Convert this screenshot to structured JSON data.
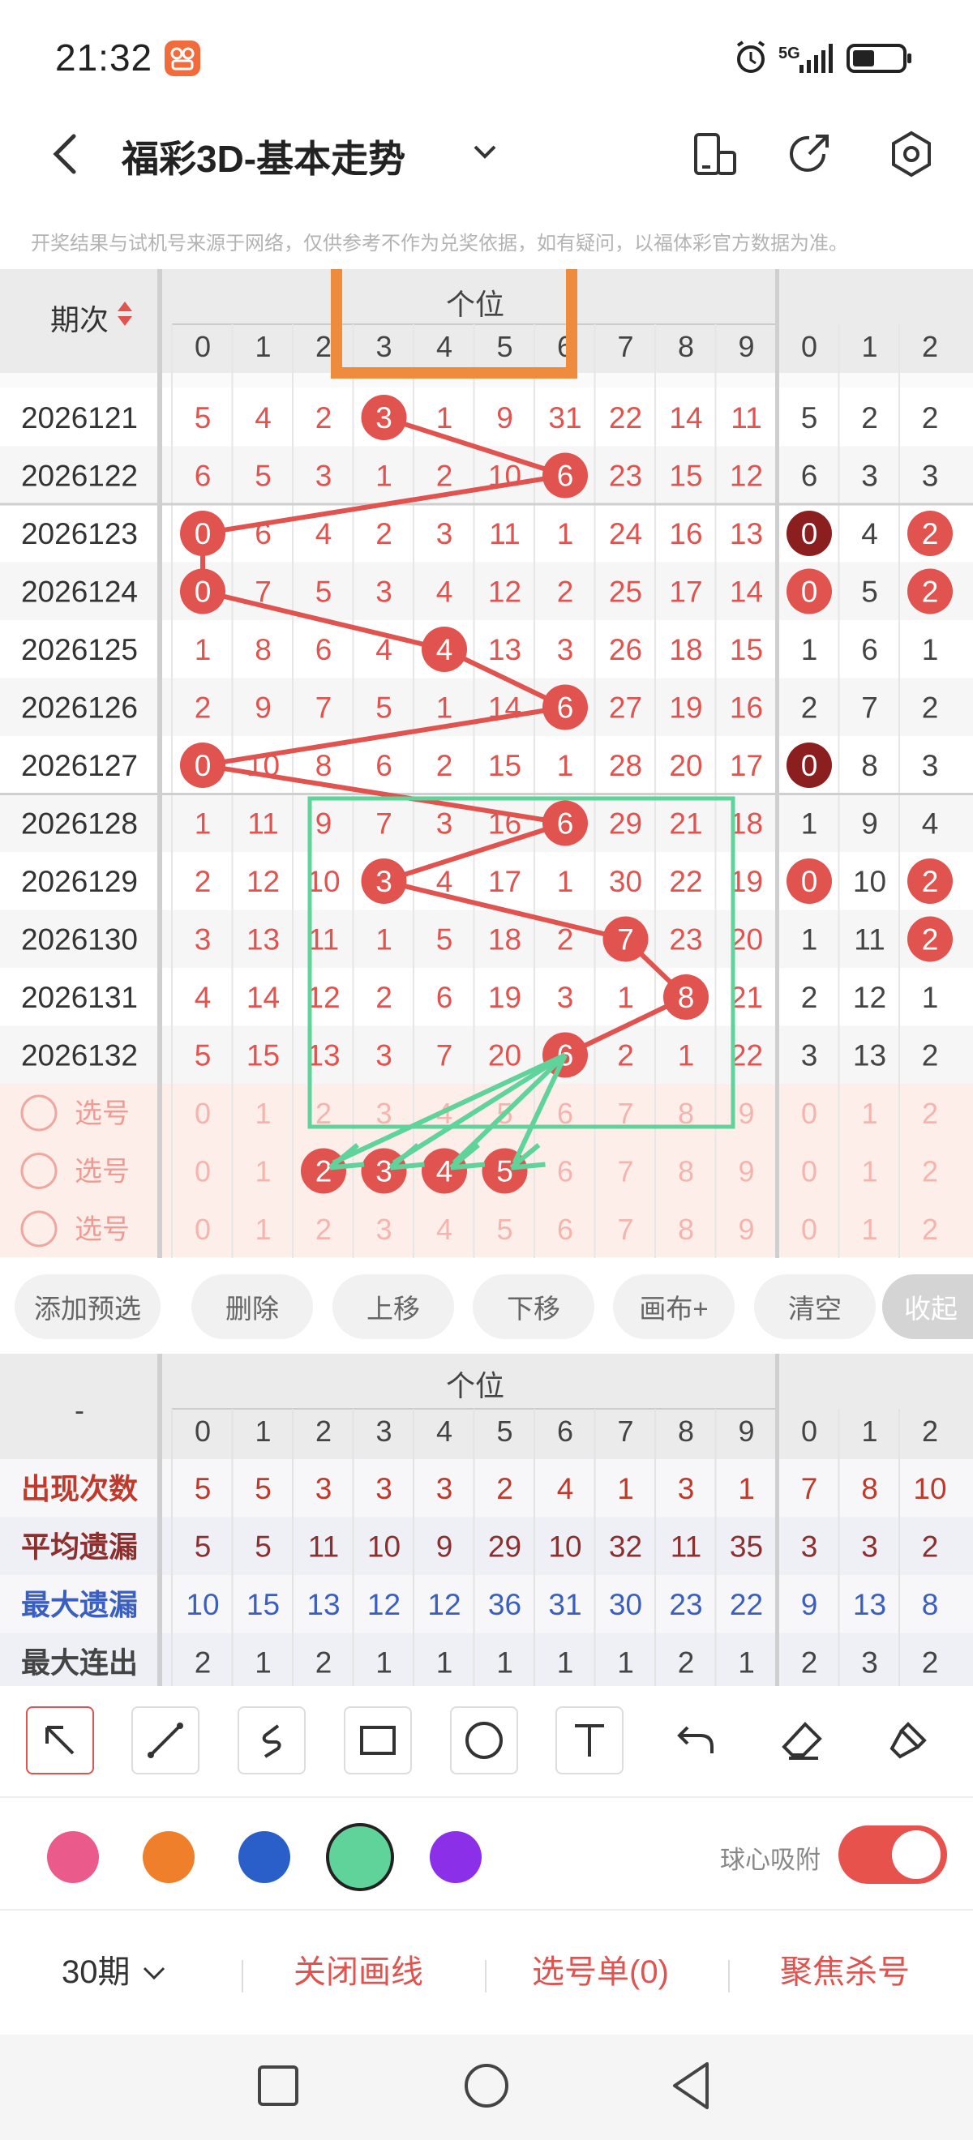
{
  "status": {
    "time": "21:32",
    "network": "5G"
  },
  "header": {
    "title": "福彩3D-基本走势"
  },
  "notice": "开奖结果与试机号来源于网络，仅供参考不作为兑奖依据，如有疑问，以福体彩官方数据为准。",
  "trend": {
    "col_header": "期次",
    "group_label": "个位",
    "digits": [
      "0",
      "1",
      "2",
      "3",
      "4",
      "5",
      "6",
      "7",
      "8",
      "9"
    ],
    "extra_digits": [
      "0",
      "1",
      "2"
    ],
    "rows": [
      {
        "period": "2026121",
        "hit": 3,
        "cells": [
          "5",
          "4",
          "2",
          "3",
          "1",
          "9",
          "31",
          "22",
          "14",
          "11"
        ],
        "extra": [
          "5",
          "2",
          "2"
        ],
        "extra_hits": []
      },
      {
        "period": "2026122",
        "hit": 6,
        "cells": [
          "6",
          "5",
          "3",
          "1",
          "2",
          "10",
          "6",
          "23",
          "15",
          "12"
        ],
        "extra": [
          "6",
          "3",
          "3"
        ],
        "extra_hits": []
      },
      {
        "period": "2026123",
        "hit": 0,
        "cells": [
          "0",
          "6",
          "4",
          "2",
          "3",
          "11",
          "1",
          "24",
          "16",
          "13"
        ],
        "extra": [
          "0",
          "4",
          "2"
        ],
        "extra_hits": [
          0,
          2
        ]
      },
      {
        "period": "2026124",
        "hit": 0,
        "cells": [
          "0",
          "7",
          "5",
          "3",
          "4",
          "12",
          "2",
          "25",
          "17",
          "14"
        ],
        "extra": [
          "0",
          "5",
          "2"
        ],
        "extra_hits": [
          0,
          2
        ]
      },
      {
        "period": "2026125",
        "hit": 4,
        "cells": [
          "1",
          "8",
          "6",
          "4",
          "4",
          "13",
          "3",
          "26",
          "18",
          "15"
        ],
        "extra": [
          "1",
          "6",
          "1"
        ],
        "extra_hits": []
      },
      {
        "period": "2026126",
        "hit": 6,
        "cells": [
          "2",
          "9",
          "7",
          "5",
          "1",
          "14",
          "6",
          "27",
          "19",
          "16"
        ],
        "extra": [
          "2",
          "7",
          "2"
        ],
        "extra_hits": []
      },
      {
        "period": "2026127",
        "hit": 0,
        "cells": [
          "0",
          "10",
          "8",
          "6",
          "2",
          "15",
          "1",
          "28",
          "20",
          "17"
        ],
        "extra": [
          "0",
          "8",
          "3"
        ],
        "extra_hits": [
          0
        ]
      },
      {
        "period": "2026128",
        "hit": 6,
        "cells": [
          "1",
          "11",
          "9",
          "7",
          "3",
          "16",
          "6",
          "29",
          "21",
          "18"
        ],
        "extra": [
          "1",
          "9",
          "4"
        ],
        "extra_hits": []
      },
      {
        "period": "2026129",
        "hit": 3,
        "cells": [
          "2",
          "12",
          "10",
          "3",
          "4",
          "17",
          "1",
          "30",
          "22",
          "19"
        ],
        "extra": [
          "0",
          "10",
          "2"
        ],
        "extra_hits": [
          0,
          2
        ]
      },
      {
        "period": "2026130",
        "hit": 7,
        "cells": [
          "3",
          "13",
          "11",
          "1",
          "5",
          "18",
          "2",
          "7",
          "23",
          "20"
        ],
        "extra": [
          "1",
          "11",
          "2"
        ],
        "extra_hits": [
          2
        ]
      },
      {
        "period": "2026131",
        "hit": 8,
        "cells": [
          "4",
          "14",
          "12",
          "2",
          "6",
          "19",
          "3",
          "1",
          "8",
          "21"
        ],
        "extra": [
          "2",
          "12",
          "1"
        ],
        "extra_hits": []
      },
      {
        "period": "2026132",
        "hit": 6,
        "cells": [
          "5",
          "15",
          "13",
          "3",
          "7",
          "20",
          "6",
          "2",
          "1",
          "22"
        ],
        "extra": [
          "3",
          "13",
          "2"
        ],
        "extra_hits": []
      }
    ],
    "select_rows": [
      {
        "label": "选号",
        "selected": []
      },
      {
        "label": "选号",
        "selected": [
          2,
          3,
          4,
          5
        ]
      },
      {
        "label": "选号",
        "selected": []
      }
    ]
  },
  "buttons": [
    "添加预选",
    "删除",
    "上移",
    "下移",
    "画布+",
    "清空",
    "收起"
  ],
  "stats": {
    "corner": "-",
    "group_label": "个位",
    "rows": [
      {
        "label": "出现次数",
        "color": "#c0392b",
        "values": [
          "5",
          "5",
          "3",
          "3",
          "3",
          "2",
          "4",
          "1",
          "3",
          "1",
          "7",
          "8",
          "10"
        ]
      },
      {
        "label": "平均遗漏",
        "color": "#8b2f2f",
        "values": [
          "5",
          "5",
          "11",
          "10",
          "9",
          "29",
          "10",
          "32",
          "11",
          "35",
          "3",
          "3",
          "2"
        ]
      },
      {
        "label": "最大遗漏",
        "color": "#3b5fc0",
        "values": [
          "10",
          "15",
          "13",
          "12",
          "12",
          "36",
          "31",
          "30",
          "23",
          "22",
          "9",
          "13",
          "8"
        ]
      },
      {
        "label": "最大连出",
        "color": "#444444",
        "values": [
          "2",
          "1",
          "2",
          "1",
          "1",
          "1",
          "1",
          "1",
          "2",
          "1",
          "2",
          "3",
          "2"
        ]
      }
    ]
  },
  "tools": [
    "select-arrow-icon",
    "line-icon",
    "freehand-icon",
    "rectangle-icon",
    "circle-icon",
    "text-icon",
    "undo-icon",
    "eraser-icon",
    "brush-icon"
  ],
  "colors": [
    "#ea5a8a",
    "#f07f2b",
    "#2a5fc9",
    "#5fd39a",
    "#8b2fe8"
  ],
  "snap_label": "球心吸附",
  "bottom": {
    "periods": "30期",
    "close_draw": "关闭画线",
    "ticket": "选号单(0)",
    "focus": "聚焦杀号"
  }
}
